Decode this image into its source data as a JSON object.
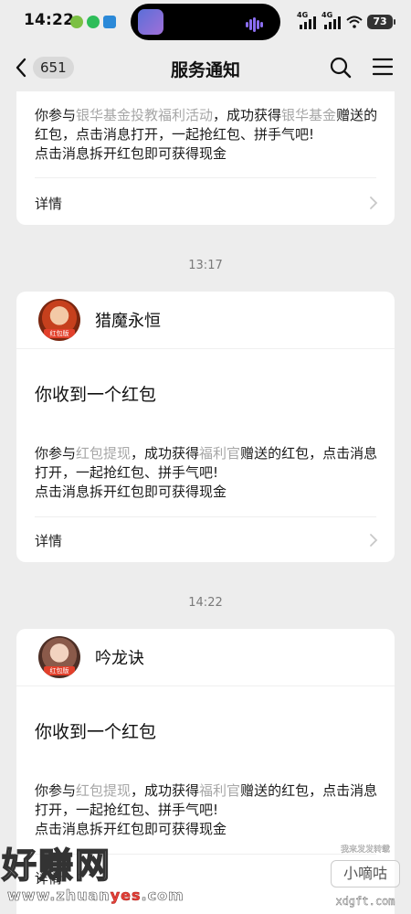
{
  "status_bar": {
    "time": "14:22",
    "signal_1": "4G",
    "signal_2": "4G",
    "battery": "73"
  },
  "nav": {
    "unread_count": "651",
    "title": "服务通知"
  },
  "messages": [
    {
      "desc_parts": [
        "你参与",
        "银华基金投教福利活动",
        "，成功获得",
        "银华基金",
        "赠送的红包，点击消息打开，一起抢红包、拼手气吧!"
      ],
      "desc_line2": "点击消息拆开红包即可获得现金",
      "details": "详情"
    },
    {
      "time": "13:17",
      "sender": "猎魔永恒",
      "avatar_tag": "红包版",
      "title": "你收到一个红包",
      "desc_parts": [
        "你参与",
        "红包提现",
        "，成功获得",
        "福利官",
        "赠送的红包，点击消息打开，一起抢红包、拼手气吧!"
      ],
      "desc_line2": "点击消息拆开红包即可获得现金",
      "details": "详情"
    },
    {
      "time": "14:22",
      "sender": "吟龙诀",
      "avatar_tag": "红包版",
      "title": "你收到一个红包",
      "desc_parts": [
        "你参与",
        "红包提现",
        "，成功获得",
        "福利官",
        "赠送的红包，点击消息打开，一起抢红包、拼手气吧!"
      ],
      "desc_line2": "点击消息拆开红包即可获得现金",
      "details": "详情"
    }
  ],
  "watermarks": {
    "left_big": "好赚网",
    "left_url_a": "www.zhuan",
    "left_url_b": "yes",
    "left_url_c": ".com",
    "right_small": "我来发发转载",
    "right_pill": "小嘀咕",
    "right_domain": "xdgft.com"
  },
  "colors": {
    "background": "#ededed",
    "card": "#ffffff",
    "highlight_text": "#a7a7a7",
    "avatar_tag": "#e2402b"
  },
  "icons": {
    "back": "chevron-left-icon",
    "search": "search-icon",
    "menu": "hamburger-menu-icon",
    "details": "chevron-right-icon"
  }
}
